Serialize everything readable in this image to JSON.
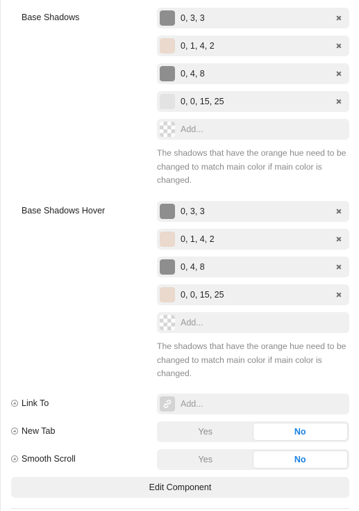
{
  "base_shadows": {
    "label": "Base Shadows",
    "items": [
      {
        "value": "0, 3, 3",
        "color": "#8e8e8e"
      },
      {
        "value": "0, 1, 4, 2",
        "color": "#ead9cc"
      },
      {
        "value": "0, 4, 8",
        "color": "#8e8e8e"
      },
      {
        "value": "0, 0, 15, 25",
        "color": "#e3e3e3"
      }
    ],
    "add_placeholder": "Add...",
    "help_text": "The shadows that have the orange hue need to be changed to match main color if main color is changed."
  },
  "base_shadows_hover": {
    "label": "Base Shadows Hover",
    "items": [
      {
        "value": "0, 3, 3",
        "color": "#8e8e8e"
      },
      {
        "value": "0, 1, 4, 2",
        "color": "#ead9cc"
      },
      {
        "value": "0, 4, 8",
        "color": "#8e8e8e"
      },
      {
        "value": "0, 0, 15, 25",
        "color": "#ead9cc"
      }
    ],
    "add_placeholder": "Add...",
    "help_text": "The shadows that have the orange hue need to be changed to match main color if main color is changed."
  },
  "link_to": {
    "label": "Link To",
    "placeholder": "Add...",
    "icon": "link-icon"
  },
  "new_tab": {
    "label": "New Tab",
    "options": [
      "Yes",
      "No"
    ],
    "selected": "No"
  },
  "smooth_scroll": {
    "label": "Smooth Scroll",
    "options": [
      "Yes",
      "No"
    ],
    "selected": "No"
  },
  "edit_component_label": "Edit Component",
  "colors": {
    "accent": "#1a82e2",
    "field_bg": "#f0f0f0"
  }
}
